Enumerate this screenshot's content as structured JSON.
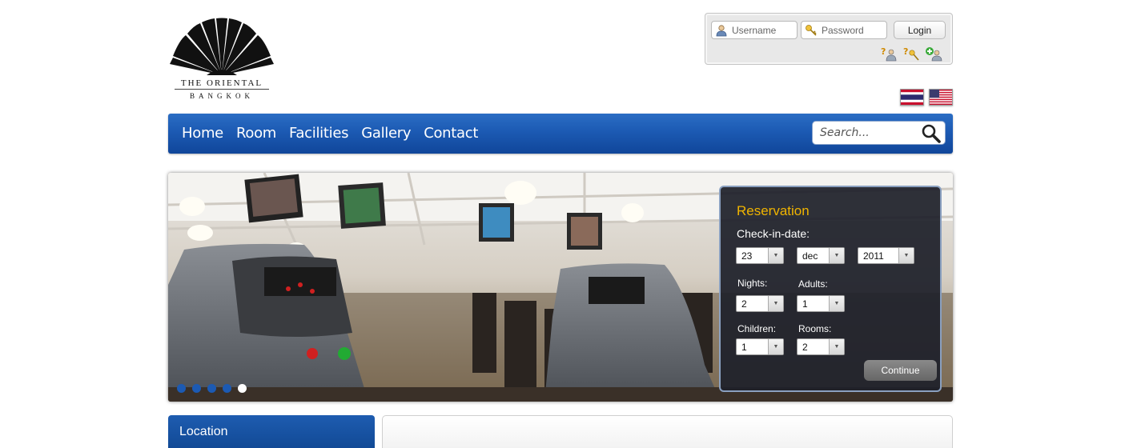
{
  "logo": {
    "line1": "THE ORIENTAL",
    "line2": "BANGKOK"
  },
  "login": {
    "username_placeholder": "Username",
    "password_placeholder": "Password",
    "login_label": "Login",
    "icons": [
      "help-user-icon",
      "help-key-icon",
      "add-user-icon"
    ]
  },
  "languages": [
    {
      "name": "thai-flag-icon"
    },
    {
      "name": "us-flag-icon"
    }
  ],
  "nav": {
    "items": [
      "Home",
      "Room",
      "Facilities",
      "Gallery",
      "Contact"
    ],
    "search_placeholder": "Search..."
  },
  "slideshow": {
    "dot_count": 5,
    "active_dot": 4
  },
  "reservation": {
    "title": "Reservation",
    "checkin_label": "Check-in-date:",
    "day": "23",
    "month": "dec",
    "year": "2011",
    "nights_label": "Nights:",
    "nights": "2",
    "adults_label": "Adults:",
    "adults": "1",
    "children_label": "Children:",
    "children": "1",
    "rooms_label": "Rooms:",
    "rooms": "2",
    "continue_label": "Continue"
  },
  "location": {
    "title": "Location"
  },
  "colors": {
    "nav_blue": "#1c5ab3",
    "reservation_title": "#f0b400",
    "panel_bg": "#1e202a"
  }
}
